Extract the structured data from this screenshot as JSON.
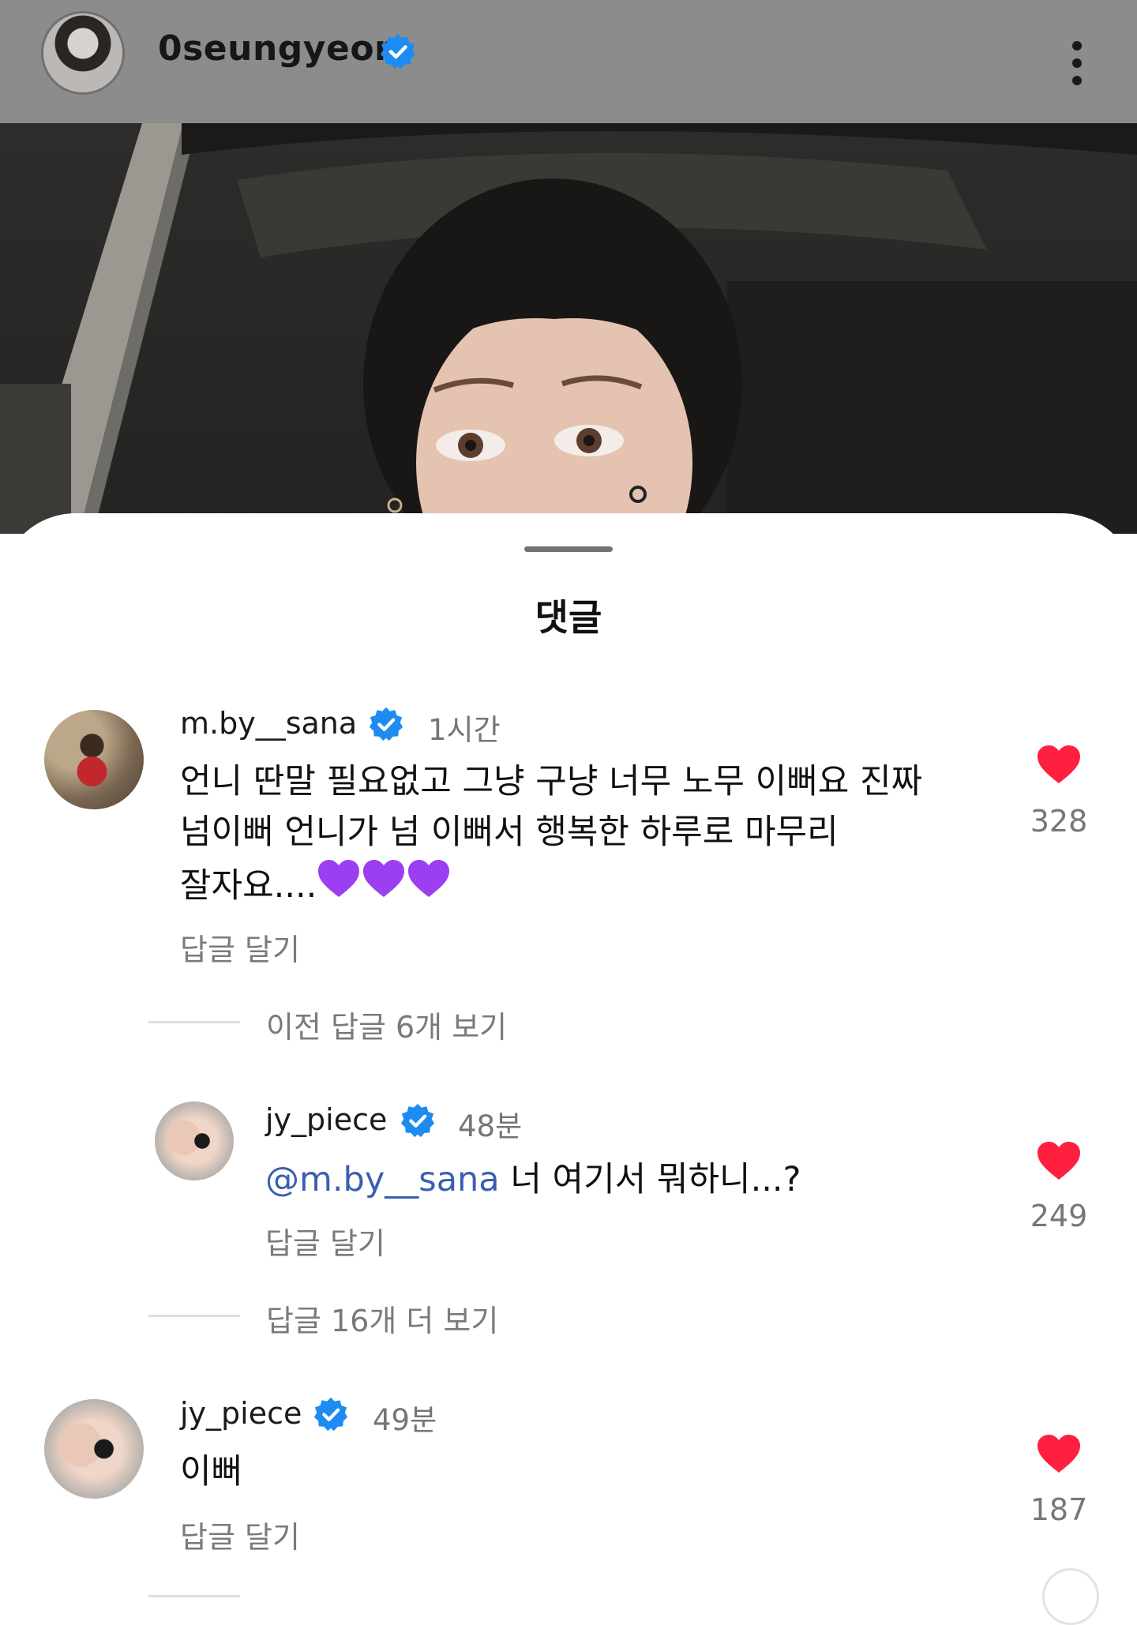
{
  "header": {
    "username": "0seungyeon"
  },
  "sheet": {
    "title": "댓글"
  },
  "comments": [
    {
      "username": "m.by__sana",
      "time": "1시간",
      "text_line1": "언니 딴말 필요없고 그냥 구냥 너무 노무 이뻐요 진짜",
      "text_line2": "넘이뻐 언니가 넘 이뻐서 행복한 하루로 마무리",
      "text_line3": "잘자요....",
      "reply_label": "답글 달기",
      "likes": "328"
    },
    {
      "username": "jy_piece",
      "time": "48분",
      "mention": "@m.by__sana",
      "text": " 너 여기서 뭐하니...?",
      "reply_label": "답글 달기",
      "likes": "249"
    },
    {
      "username": "jy_piece",
      "time": "49분",
      "text": "이뻐",
      "reply_label": "답글 달기",
      "likes": "187"
    }
  ],
  "threads": {
    "previous_replies": "이전 답글 6개 보기",
    "more_replies": "답글 16개 더 보기"
  },
  "colors": {
    "verified": "#1d8bf1",
    "heart": "#ff2040",
    "mention": "#3a5fb0",
    "topbar": "#8c8c8c"
  },
  "icons": [
    "verified-badge-icon",
    "more-vert-icon",
    "heart-icon"
  ]
}
